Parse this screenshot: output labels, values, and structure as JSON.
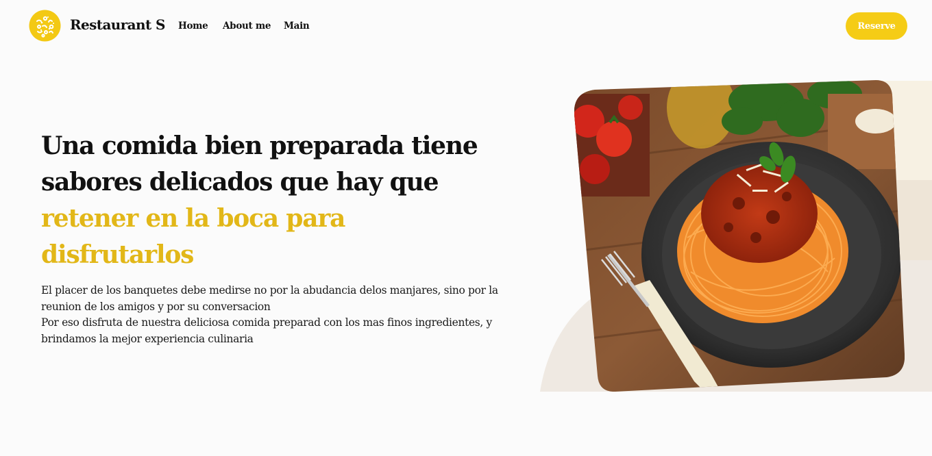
{
  "header": {
    "brand": "Restaurant S",
    "logo_icon": "pasta-bowl-icon",
    "nav": {
      "home": "Home",
      "about": "About me",
      "main": "Main"
    },
    "reserve_label": "Reserve"
  },
  "hero": {
    "headline_plain": "Una comida bien preparada tiene sabores delicados que hay que",
    "headline_accent": "retener en la boca para disfrutarlos",
    "paragraph_line1": "El placer de los banquetes debe medirse no por la abudancia delos manjares, sino por la reunion de los amigos y por su conversacion",
    "paragraph_line2": "Por eso disfruta de nuestra deliciosa comida preparad con los mas finos ingredientes, y brindamos la mejor experiencia culinaria",
    "image_subject": "spaghetti-bolognese-photo"
  },
  "colors": {
    "accent": "#f5cc16",
    "accent_text": "#e2b718",
    "page_bg": "#fbfbfb",
    "text": "#111111",
    "deco_light": "#f5efe2",
    "deco_mid": "#ece4d7"
  }
}
